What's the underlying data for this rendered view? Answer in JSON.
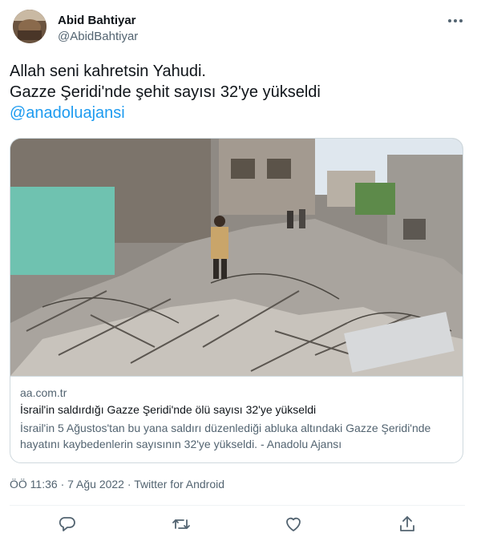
{
  "author": {
    "name": "Abid Bahtiyar",
    "handle": "@AbidBahtiyar"
  },
  "tweet": {
    "line1": "Allah seni kahretsin Yahudi.",
    "line2": "Gazze Şeridi'nde şehit sayısı 32'ye yükseldi",
    "mention": "@anadoluajansi"
  },
  "card": {
    "domain": "aa.com.tr",
    "title": "İsrail'in saldırdığı Gazze Şeridi'nde ölü sayısı 32'ye yükseldi",
    "description": "İsrail'in 5 Ağustos'tan bu yana saldırı düzenlediği abluka altındaki Gazze Şeridi'nde hayatını kaybedenlerin sayısının 32'ye yükseldi. - Anadolu Ajansı"
  },
  "meta": {
    "time": "ÖÖ 11:36",
    "separator1": "·",
    "date": "7 Ağu 2022",
    "separator2": "·",
    "source": "Twitter for Android"
  },
  "icons": {
    "more": "more-icon",
    "reply": "reply-icon",
    "retweet": "retweet-icon",
    "like": "like-icon",
    "share": "share-icon"
  },
  "colors": {
    "link": "#1d9bf0",
    "secondary_text": "#536471",
    "border": "#cfd9de"
  }
}
